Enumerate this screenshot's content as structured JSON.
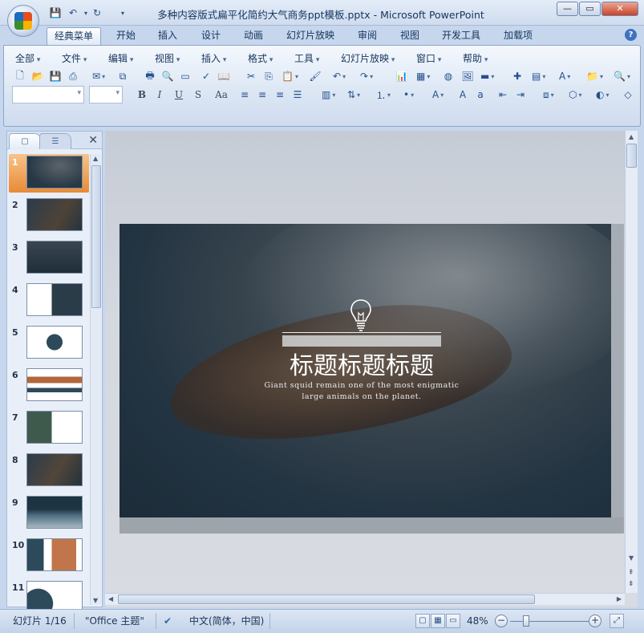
{
  "window": {
    "title": "多种内容版式扁平化简约大气商务ppt模板.pptx - Microsoft PowerPoint",
    "minimize": "—",
    "maximize": "▭",
    "close": "✕"
  },
  "ribbon_tabs": [
    "经典菜单",
    "开始",
    "插入",
    "设计",
    "动画",
    "幻灯片放映",
    "审阅",
    "视图",
    "开发工具",
    "加载项"
  ],
  "active_tab": "经典菜单",
  "menus": [
    "全部",
    "文件",
    "编辑",
    "视图",
    "插入",
    "格式",
    "工具",
    "幻灯片放映",
    "窗口",
    "帮助"
  ],
  "format_buttons": [
    "B",
    "I",
    "U",
    "S",
    "Aa"
  ],
  "slide_panel": {
    "tabs": [
      "slides",
      "outline"
    ],
    "close": "✕",
    "slide_numbers": [
      "1",
      "2",
      "3",
      "4",
      "5",
      "6",
      "7",
      "8",
      "9",
      "10",
      "11"
    ],
    "selected": "1"
  },
  "slide": {
    "title": "标题标题标题",
    "subtitle_line1": "Giant squid remain one of the most enigmatic",
    "subtitle_line2": "large animals on the planet."
  },
  "status": {
    "slide_counter": "幻灯片 1/16",
    "theme": "\"Office 主题\"",
    "language": "中文(简体，中国)",
    "zoom": "48%"
  },
  "colors": {
    "slide_background": "#223341",
    "accent_selection": "#e88a36",
    "ribbon": "#dbe6f4"
  }
}
